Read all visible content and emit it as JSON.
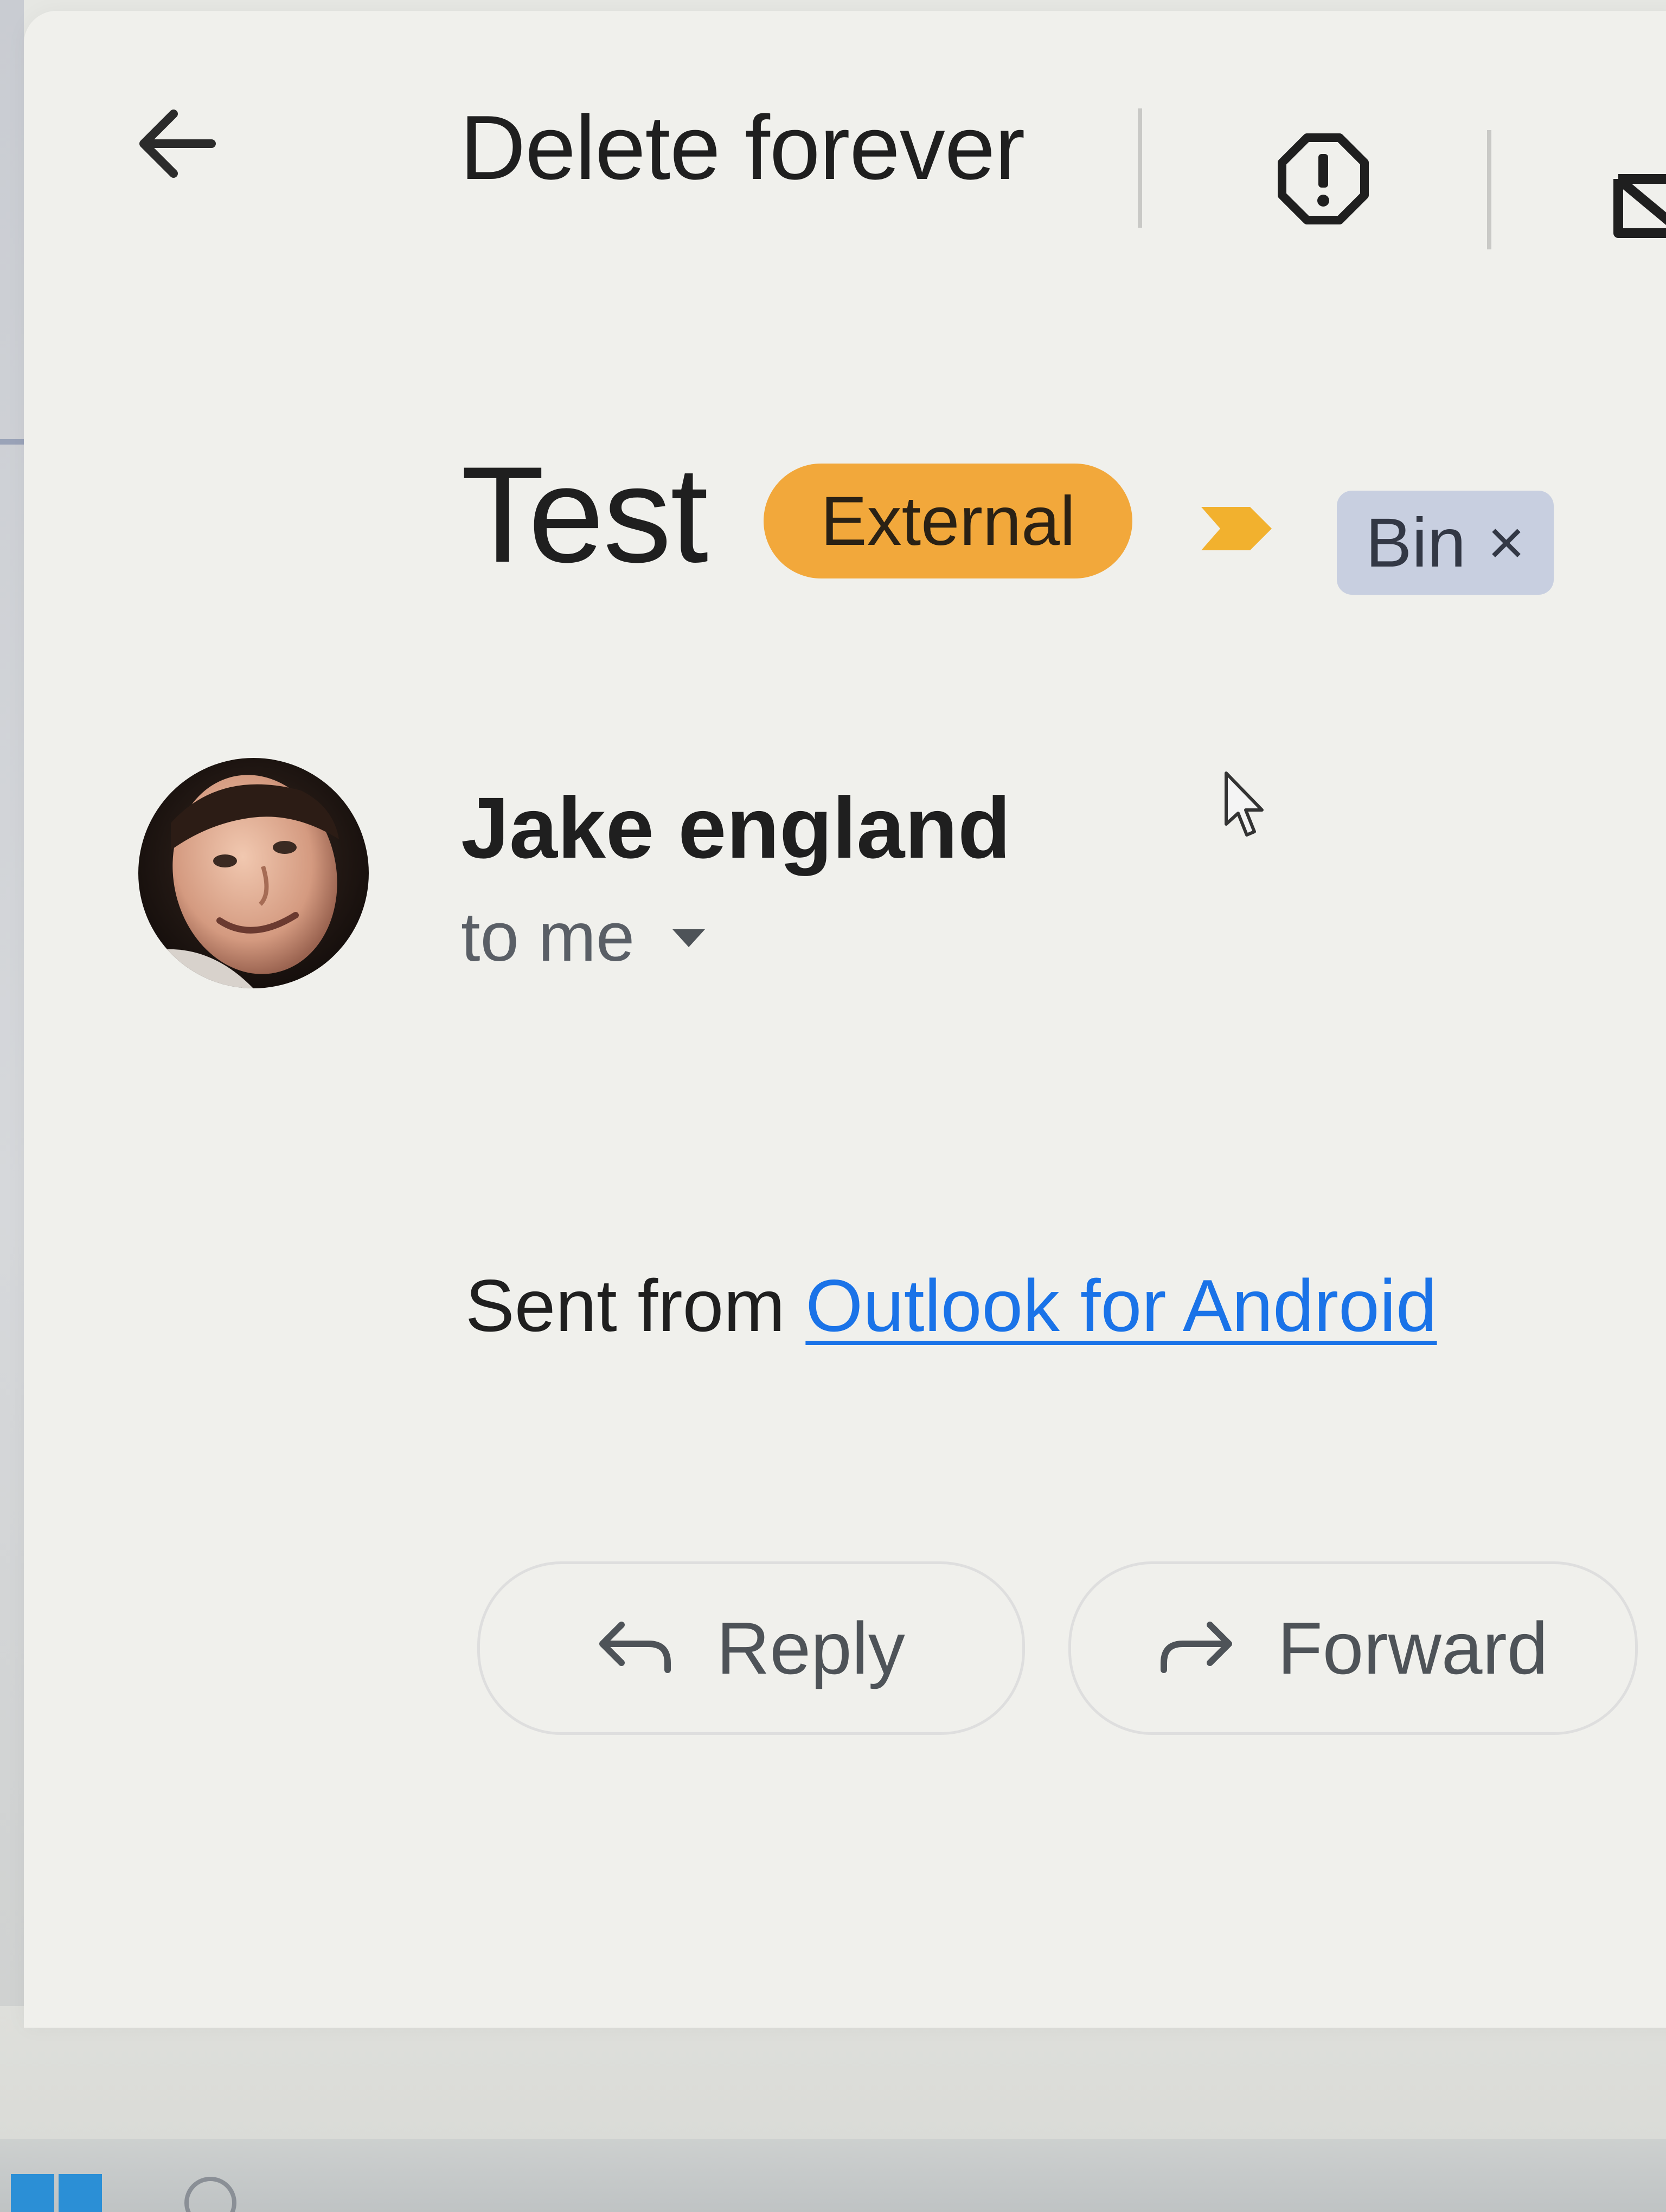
{
  "toolbar": {
    "back_icon": "arrow-left-icon",
    "delete_forever_label": "Delete forever",
    "report_icon": "report-spam-icon",
    "mark_icon": "mark-unread-icon"
  },
  "email": {
    "subject": "Test",
    "labels": [
      {
        "name": "External",
        "color": "#f2a83b"
      },
      {
        "name": "Bin",
        "color": "#c8cfe0",
        "removable": true,
        "remove_glyph": "×"
      }
    ],
    "important_marker_color": "#f2b12e",
    "sender_name": "Jake england",
    "recipient_label": "to me",
    "body_prefix": "Sent from ",
    "body_link": "Outlook for Android",
    "link_color": "#1a73e8"
  },
  "actions": {
    "reply_label": "Reply",
    "forward_label": "Forward"
  }
}
